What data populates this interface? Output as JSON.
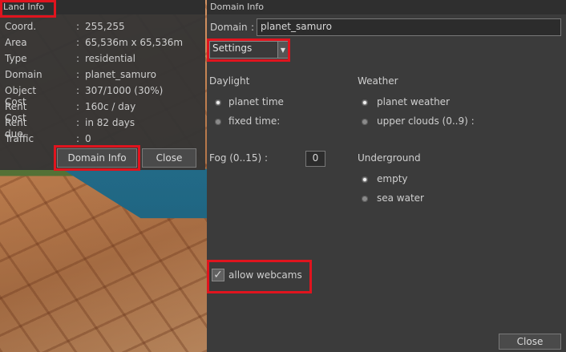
{
  "land_info": {
    "title": "Land Info",
    "rows": [
      {
        "key": "Coord.",
        "value": "255,255"
      },
      {
        "key": "Area",
        "value": "65,536m x 65,536m"
      },
      {
        "key": "Type",
        "value": "residential"
      },
      {
        "key": "Domain",
        "value": "planet_samuro"
      },
      {
        "key": "Object Cost",
        "value": "307/1000 (30%)"
      },
      {
        "key": "Rent Cost",
        "value": "160c / day"
      },
      {
        "key": "Rent due",
        "value": "in 82 days"
      },
      {
        "key": "Traffic",
        "value": "0"
      }
    ],
    "colon": ":",
    "domain_info_button": "Domain Info",
    "close_button": "Close"
  },
  "domain_info": {
    "title": "Domain Info",
    "domain_label": "Domain",
    "colon": ":",
    "domain_value": "planet_samuro",
    "select_value": "Settings",
    "daylight": {
      "heading": "Daylight",
      "options": [
        "planet time",
        "fixed time:"
      ],
      "selected": 0
    },
    "weather": {
      "heading": "Weather",
      "options": [
        "planet weather",
        "upper clouds (0..9) :"
      ],
      "selected": 0
    },
    "fog": {
      "label": "Fog (0..15) :",
      "value": "0"
    },
    "underground": {
      "heading": "Underground",
      "options": [
        "empty",
        "sea water"
      ],
      "selected": 0
    },
    "webcams": {
      "label": "allow webcams",
      "checked": true,
      "check_glyph": "✓"
    },
    "close_button": "Close"
  },
  "highlight_color": "#e0141e"
}
